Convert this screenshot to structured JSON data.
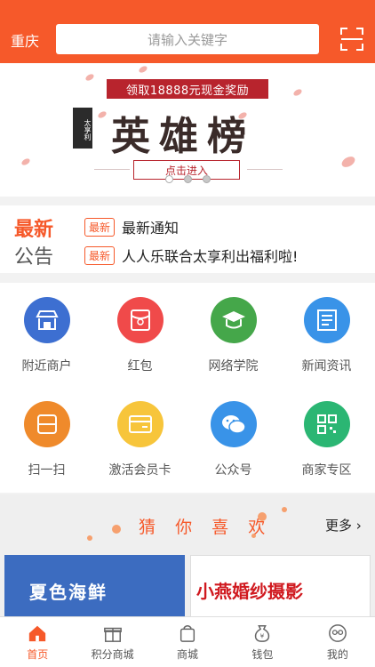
{
  "header": {
    "city": "重庆",
    "search_placeholder": "请输入关键字"
  },
  "banner": {
    "top_text": "领取18888元现金奖励",
    "title": "英雄榜",
    "side_text": "太享利",
    "button": "点击进入"
  },
  "notice": {
    "latest_label": "最新",
    "announce_label": "公告",
    "items": [
      {
        "badge": "最新",
        "text": "最新通知"
      },
      {
        "badge": "最新",
        "text": "人人乐联合太享利出福利啦!"
      }
    ]
  },
  "grid": {
    "items": [
      {
        "label": "附近商户",
        "color": "#3d6fd1",
        "icon": "shop-icon"
      },
      {
        "label": "红包",
        "color": "#f04a4a",
        "icon": "red-packet-icon"
      },
      {
        "label": "网络学院",
        "color": "#45a74a",
        "icon": "graduation-cap-icon"
      },
      {
        "label": "新闻资讯",
        "color": "#3993e8",
        "icon": "news-icon"
      },
      {
        "label": "扫一扫",
        "color": "#ef8a2b",
        "icon": "scan-icon"
      },
      {
        "label": "激活会员卡",
        "color": "#f7c53b",
        "icon": "member-card-icon"
      },
      {
        "label": "公众号",
        "color": "#3993e8",
        "icon": "wechat-icon"
      },
      {
        "label": "商家专区",
        "color": "#2bb673",
        "icon": "qr-code-icon"
      }
    ]
  },
  "guess": {
    "title_chars": [
      "猜",
      "你",
      "喜",
      "欢"
    ],
    "more": "更多"
  },
  "shops": {
    "shop1_sign": "夏色海鲜",
    "shop2_sign": "小燕婚纱摄影"
  },
  "tabbar": {
    "items": [
      {
        "label": "首页",
        "icon": "home-icon",
        "active": true
      },
      {
        "label": "积分商城",
        "icon": "gift-icon",
        "active": false
      },
      {
        "label": "商城",
        "icon": "shopping-bag-icon",
        "active": false
      },
      {
        "label": "钱包",
        "icon": "wallet-icon",
        "active": false
      },
      {
        "label": "我的",
        "icon": "profile-icon",
        "active": false
      }
    ]
  },
  "colors": {
    "accent": "#f6592a"
  }
}
